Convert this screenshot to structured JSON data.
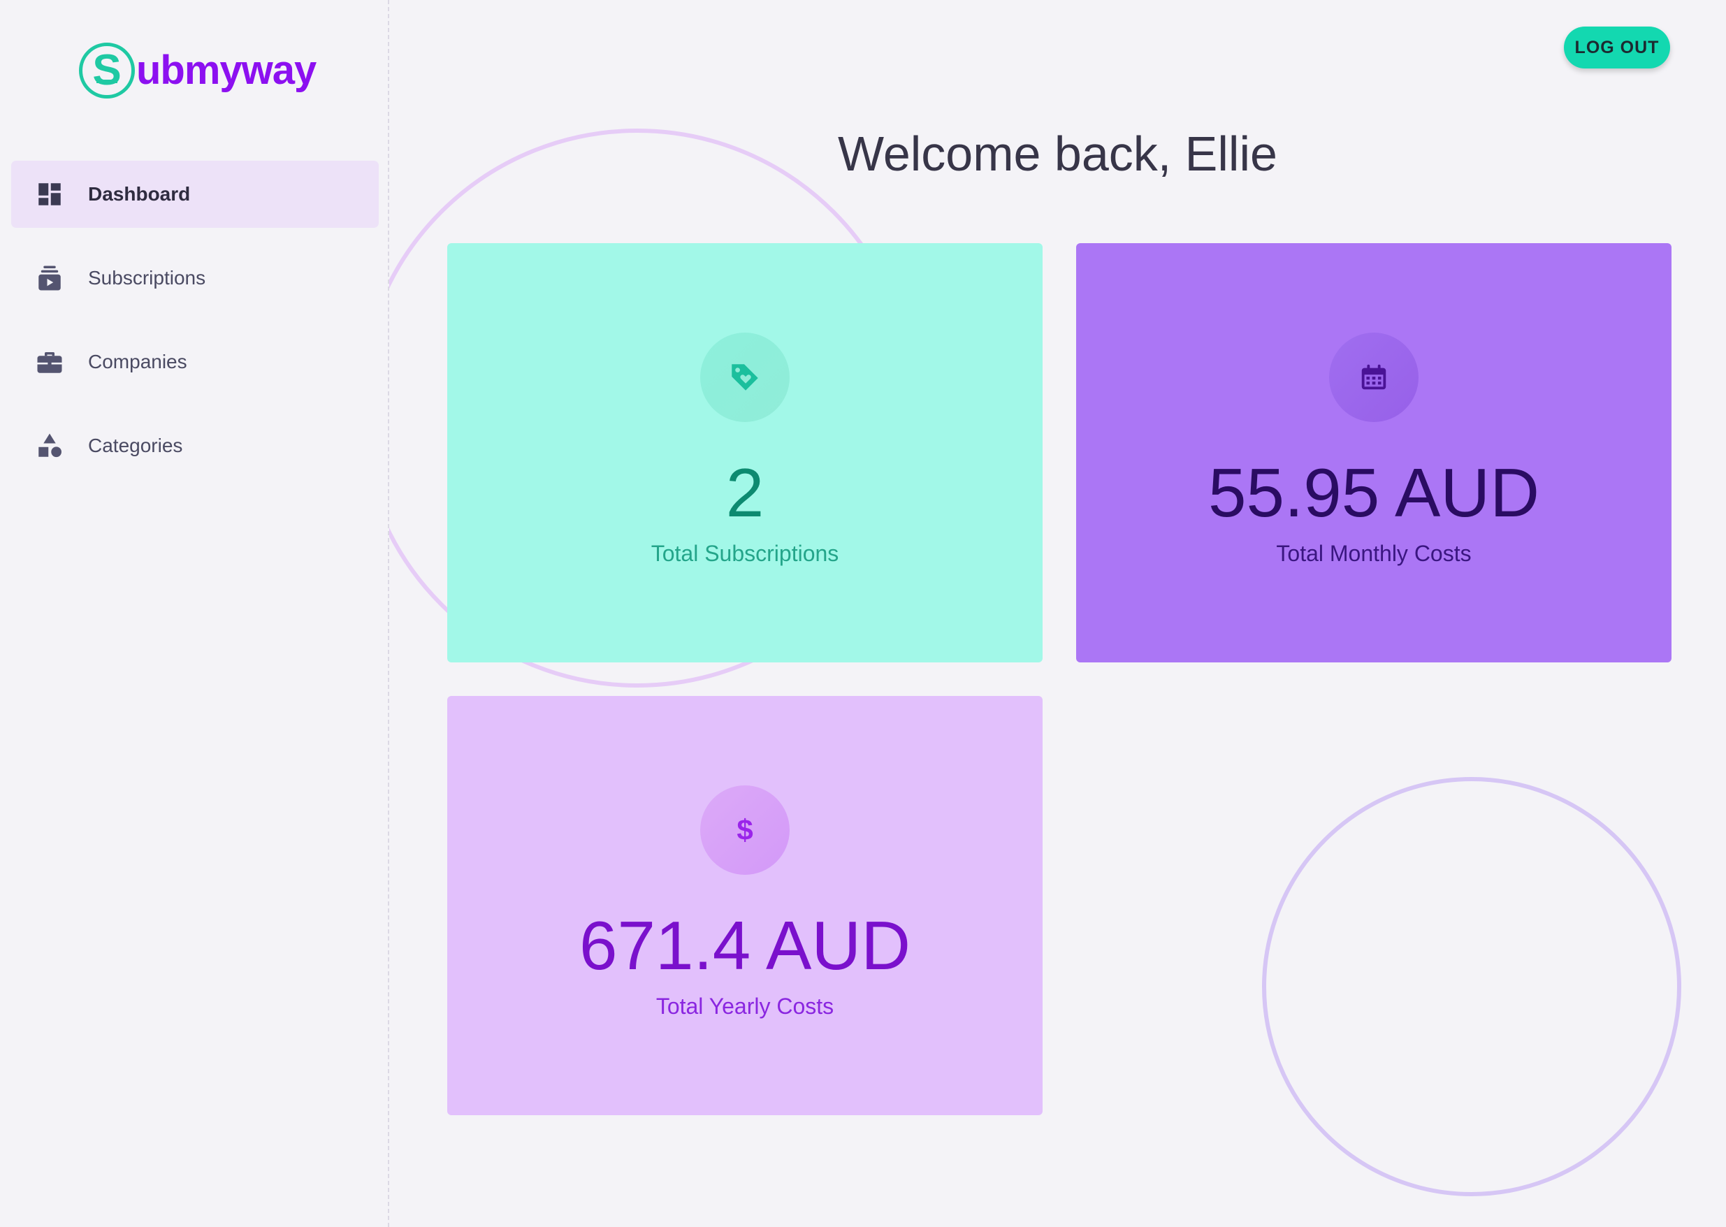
{
  "brand": {
    "logo_letter": "S",
    "logo_text": "ubmyway",
    "colors": {
      "teal": "#1fc9a3",
      "purple": "#8c10f0"
    }
  },
  "sidebar": {
    "items": [
      {
        "label": "Dashboard",
        "icon": "dashboard-icon",
        "active": true
      },
      {
        "label": "Subscriptions",
        "icon": "subscriptions-icon",
        "active": false
      },
      {
        "label": "Companies",
        "icon": "briefcase-icon",
        "active": false
      },
      {
        "label": "Categories",
        "icon": "shapes-icon",
        "active": false
      }
    ]
  },
  "header": {
    "logout_label": "LOG OUT",
    "welcome": "Welcome back, Ellie"
  },
  "stats": [
    {
      "value": "2",
      "label": "Total Subscriptions",
      "icon": "tag-heart-icon",
      "color": "#a2f8e8"
    },
    {
      "value": "55.95 AUD",
      "label": "Total Monthly Costs",
      "icon": "calendar-icon",
      "color": "#ab76f5"
    },
    {
      "value": "671.4 AUD",
      "label": "Total Yearly Costs",
      "icon": "dollar-icon",
      "icon_glyph": "$",
      "color": "#e2c0fc"
    }
  ]
}
